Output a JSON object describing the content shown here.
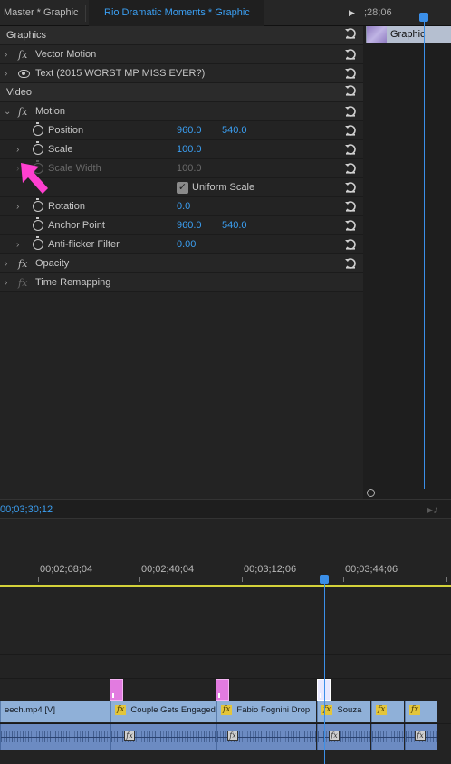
{
  "tabs": {
    "master": "Master * Graphic",
    "active": "Rio Dramatic Moments * Graphic"
  },
  "mini_timeline": {
    "time": ";28;06",
    "clip_label": "Graphic"
  },
  "sections": {
    "graphics": "Graphics",
    "video": "Video"
  },
  "graphics_items": [
    {
      "label": "Vector Motion"
    },
    {
      "label": "Text (2015 WORST MP MISS EVER?)"
    }
  ],
  "motion": {
    "label": "Motion",
    "position": {
      "label": "Position",
      "x": "960.0",
      "y": "540.0"
    },
    "scale": {
      "label": "Scale",
      "value": "100.0"
    },
    "scale_width": {
      "label": "Scale Width",
      "value": "100.0"
    },
    "uniform_scale": {
      "label": "Uniform Scale",
      "checked": true
    },
    "rotation": {
      "label": "Rotation",
      "value": "0.0"
    },
    "anchor_point": {
      "label": "Anchor Point",
      "x": "960.0",
      "y": "540.0"
    },
    "anti_flicker": {
      "label": "Anti-flicker Filter",
      "value": "0.00"
    }
  },
  "opacity": {
    "label": "Opacity"
  },
  "time_remapping": {
    "label": "Time Remapping"
  },
  "timecode": "00;03;30;12",
  "ruler_ticks": [
    "00;02;08;04",
    "00;02;40;04",
    "00;03;12;06",
    "00;03;44;06"
  ],
  "video_clips": [
    {
      "label": "eech.mp4 [V]",
      "has_fx": false
    },
    {
      "label": "Couple Gets Engaged",
      "has_fx": true
    },
    {
      "label": "Fabio Fognini Drop",
      "has_fx": true
    },
    {
      "label": "Souza",
      "has_fx": true
    },
    {
      "label": "",
      "has_fx": true
    },
    {
      "label": "",
      "has_fx": true
    }
  ],
  "colors": {
    "accent_blue": "#3b9ff2",
    "graphic_clip": "#e27be0",
    "video_clip": "#8fb0d8",
    "audio_clip": "#6c8bc2",
    "fx_badge": "#e3c53b",
    "arrow": "#ff3fd0"
  }
}
